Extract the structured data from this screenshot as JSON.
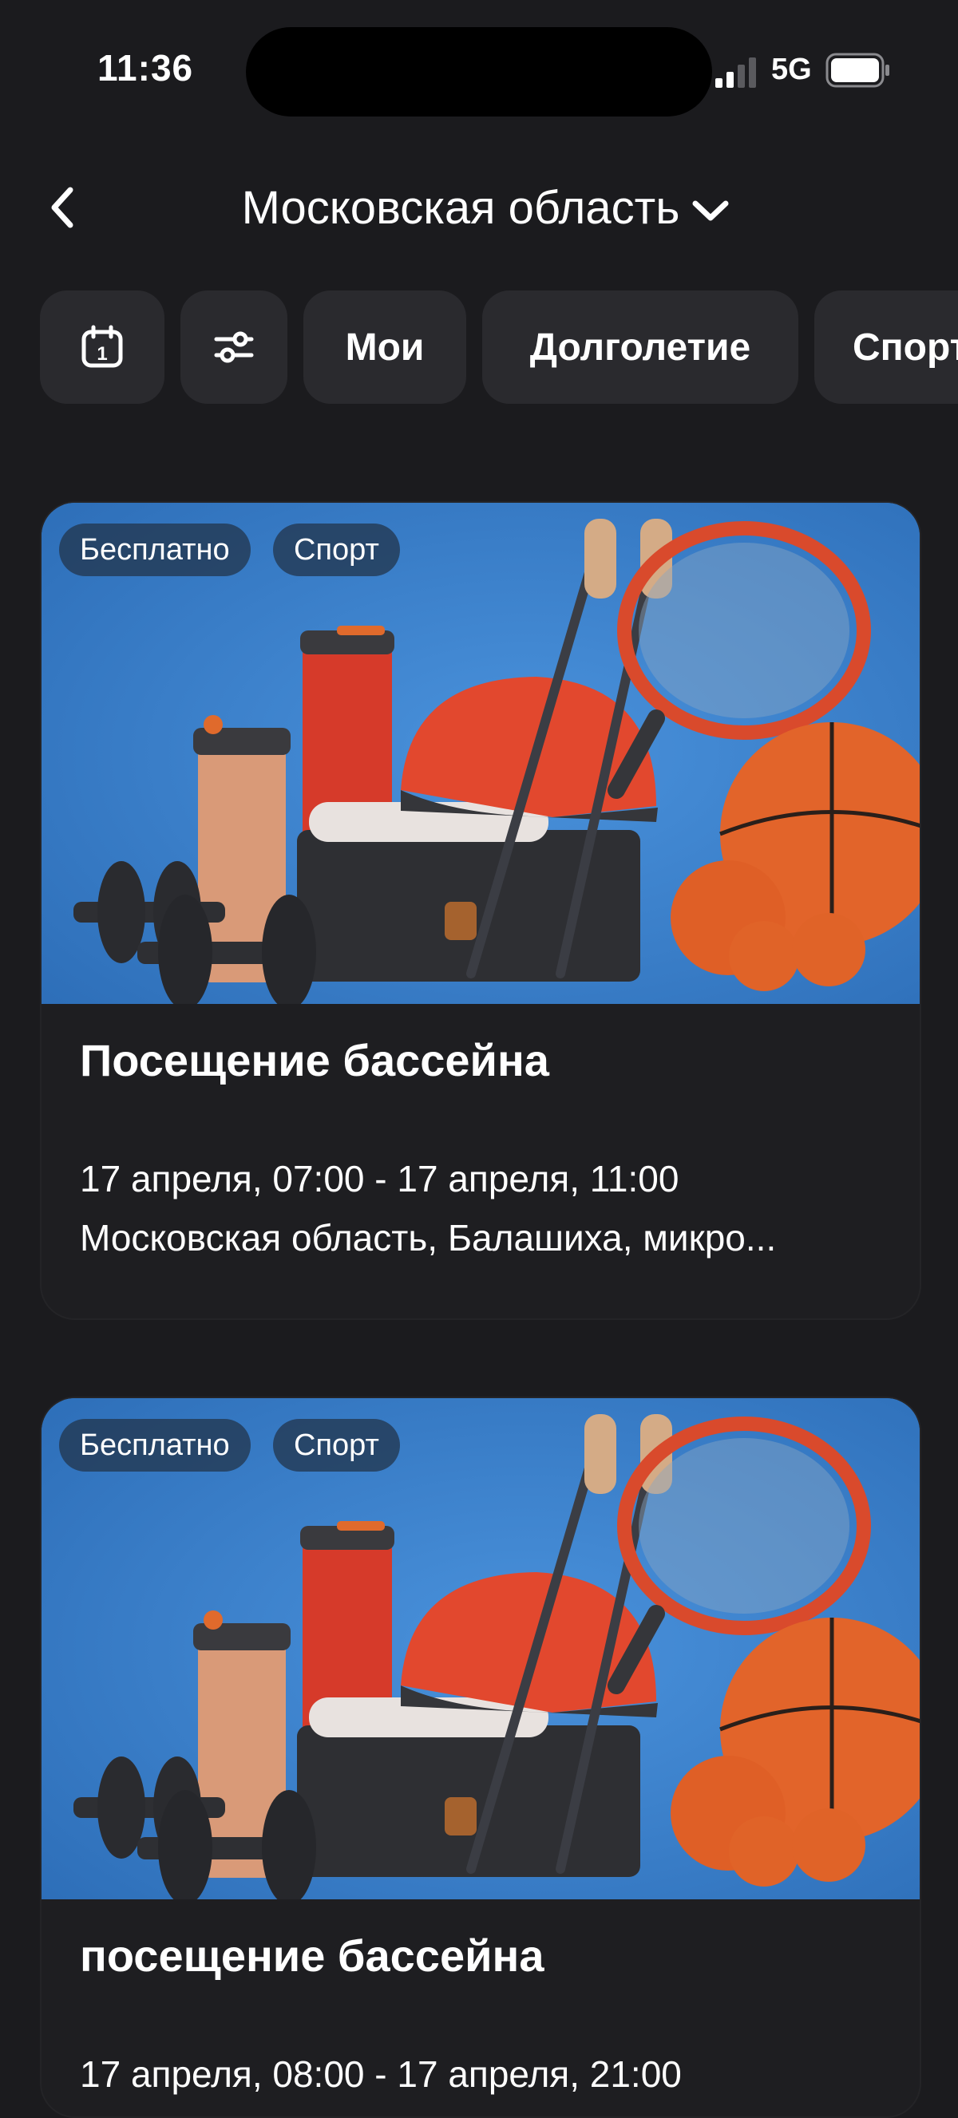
{
  "status_bar": {
    "time": "11:36",
    "network": "5G",
    "icons": [
      "signal-icon",
      "battery-icon"
    ]
  },
  "header": {
    "back_icon": "chevron-left-icon",
    "region": "Московская область",
    "dropdown_icon": "chevron-down-icon"
  },
  "filters": {
    "icons": [
      "calendar-icon",
      "sliders-icon"
    ],
    "chips": [
      "Мои",
      "Долголетие",
      "Спорт"
    ]
  },
  "events": [
    {
      "badges": [
        "Бесплатно",
        "Спорт"
      ],
      "title": "Посещение бассейна",
      "date": "17 апреля, 07:00 - 17 апреля, 11:00",
      "address": "Московская область, Балашиха, микро..."
    },
    {
      "badges": [
        "Бесплатно",
        "Спорт"
      ],
      "title": "посещение бассейна",
      "date": "17 апреля, 08:00 - 17 апреля, 21:00",
      "address": ""
    }
  ],
  "colors": {
    "background": "#1b1b1e",
    "chip": "#2a2a2e",
    "card": "#1e1e21",
    "image_blue": "#3a7dc8",
    "accent_orange": "#e06a2c"
  }
}
